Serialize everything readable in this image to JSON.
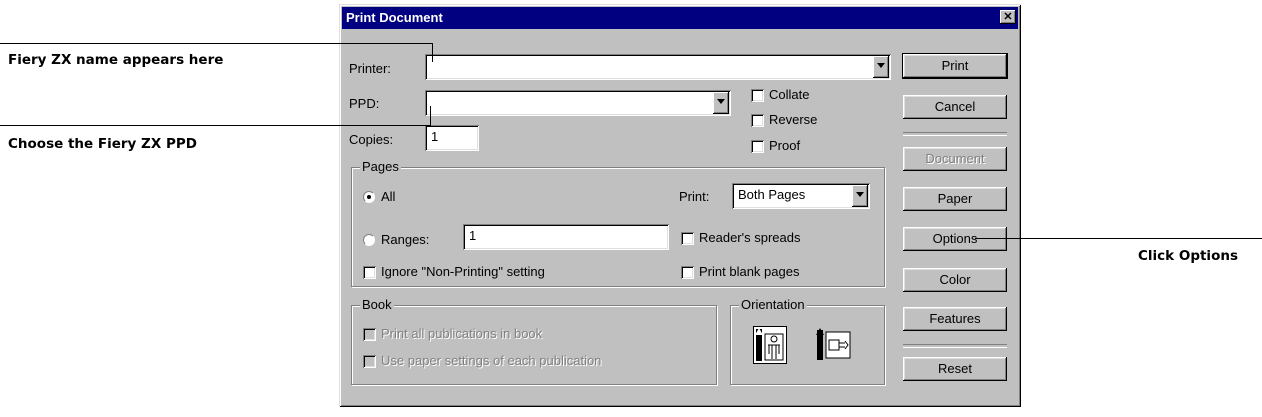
{
  "callouts": {
    "printer_name": "Fiery ZX name appears here",
    "ppd": "Choose the Fiery ZX PPD",
    "options": "Click Options"
  },
  "dialog": {
    "title": "Print Document",
    "close_glyph": "✕",
    "printer_label": "Printer:",
    "printer_value": "",
    "ppd_label": "PPD:",
    "ppd_value": "",
    "copies_label": "Copies:",
    "copies_value": "1",
    "collate": "Collate",
    "reverse": "Reverse",
    "proof": "Proof",
    "pages": {
      "title": "Pages",
      "all": "All",
      "ranges": "Ranges:",
      "ranges_value": "1",
      "ignore": "Ignore \"Non-Printing\" setting",
      "print_label": "Print:",
      "print_value": "Both Pages",
      "readers": "Reader's spreads",
      "blank": "Print blank pages"
    },
    "book": {
      "title": "Book",
      "all_pubs": "Print all publications in book",
      "paper_settings": "Use paper settings of each publication"
    },
    "orientation": {
      "title": "Orientation"
    },
    "buttons": {
      "print": "Print",
      "cancel": "Cancel",
      "document": "Document",
      "paper": "Paper",
      "options": "Options",
      "color": "Color",
      "features": "Features",
      "reset": "Reset"
    }
  }
}
